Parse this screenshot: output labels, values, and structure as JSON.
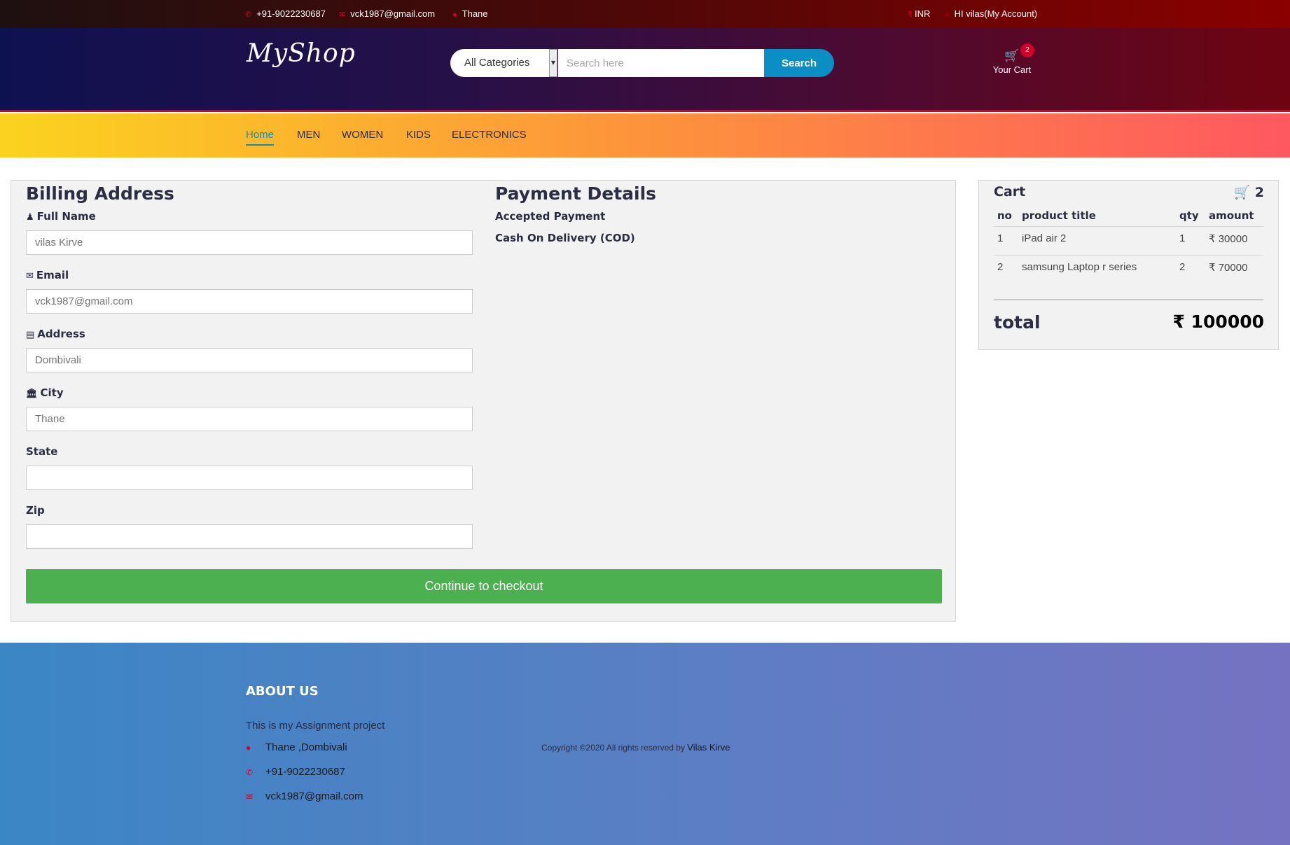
{
  "topbar": {
    "phone": "+91-9022230687",
    "email": "vck1987@gmail.com",
    "location": "Thane",
    "currency": "INR",
    "account": "HI vilas(My Account)"
  },
  "header": {
    "logo": "MyShop",
    "category_selected": "All Categories",
    "search_placeholder": "Search here",
    "search_button": "Search",
    "cart_count": "2",
    "cart_label": "Your Cart"
  },
  "nav": {
    "items": [
      "Home",
      "MEN",
      "WOMEN",
      "KIDS",
      "ELECTRONICS"
    ]
  },
  "billing": {
    "title": "Billing Address",
    "fields": [
      {
        "label": "Full Name",
        "value": ""
      },
      {
        "label": "Email",
        "value": ""
      },
      {
        "label": "Address",
        "value": ""
      },
      {
        "label": "City",
        "value": ""
      },
      {
        "label": "State",
        "value": ""
      },
      {
        "label": "Zip",
        "value": ""
      }
    ],
    "placeholders": [
      "vilas Kirve",
      "vck1987@gmail.com",
      "Dombivali",
      "Thane",
      "",
      ""
    ]
  },
  "payment": {
    "title": "Payment Details",
    "accepted_label": "Accepted Payment",
    "method": "Cash On Delivery (COD)"
  },
  "checkout_button": "Continue to checkout",
  "cart": {
    "title": "Cart",
    "count_icon": "cart-icon",
    "count": "2",
    "columns": [
      "no",
      "product title",
      "qty",
      "amount"
    ],
    "rows": [
      {
        "no": "1",
        "title": "iPad air 2",
        "qty": "1",
        "amount": "₹ 30000"
      },
      {
        "no": "2",
        "title": "samsung Laptop r series",
        "qty": "2",
        "amount": "₹ 70000"
      }
    ],
    "total_label": "total",
    "total_value": "₹ 100000"
  },
  "footer": {
    "heading": "ABOUT US",
    "text": "This is my Assignment project",
    "address": "Thane ,Dombivali",
    "phone": "+91-9022230687",
    "email": "vck1987@gmail.com",
    "copyright": "Copyright ©2020 All rights reserved by",
    "author": "Vilas Kirve"
  },
  "colors": {
    "accent": "#d10024",
    "link": "#0b8ec4",
    "checkout": "#4caf50"
  }
}
